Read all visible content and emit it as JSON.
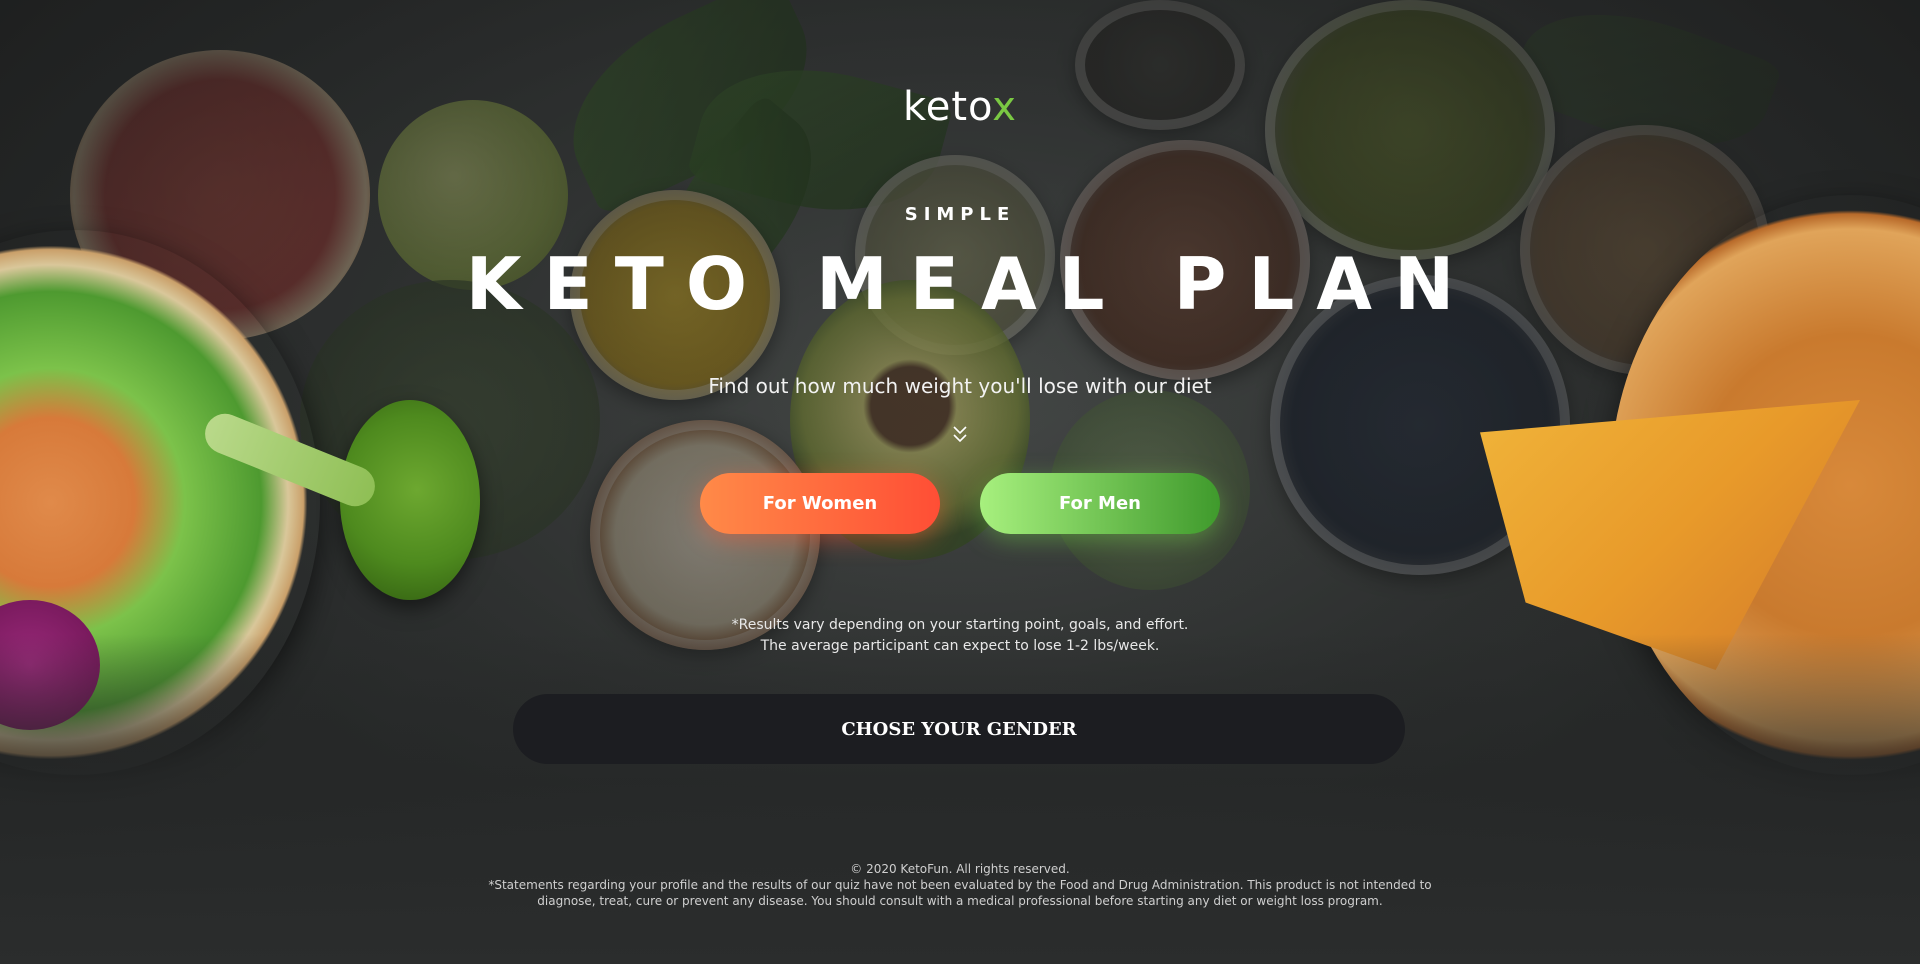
{
  "brand": {
    "logo_main": "keto",
    "logo_accent": "x",
    "accent_color": "#7ac943"
  },
  "hero": {
    "eyebrow": "SIMPLE",
    "title": "KETO MEAL PLAN",
    "subtitle": "Find out how much weight  you'll lose with our diet",
    "scroll_icon": "double-chevron-down-icon"
  },
  "buttons": {
    "women_label": "For Women",
    "men_label": "For Men",
    "women_colors": [
      "#ff8a48",
      "#ff4e35"
    ],
    "men_colors": [
      "#a7f07e",
      "#3f9a2c"
    ]
  },
  "disclaimer": {
    "line1": "*Results vary depending on your starting point, goals, and effort.",
    "line2": "The average participant can expect to lose 1-2 lbs/week."
  },
  "cta": {
    "label": "CHOSE YOUR GENDER"
  },
  "footer": {
    "copyright": "© 2020 KetoFun. All rights reserved.",
    "legal": "*Statements regarding your profile and the results of our quiz have not been evaluated by the Food and Drug Administration. This product is not intended to diagnose, treat, cure or prevent any disease. You should consult with a medical professional before starting any diet or weight loss program."
  }
}
